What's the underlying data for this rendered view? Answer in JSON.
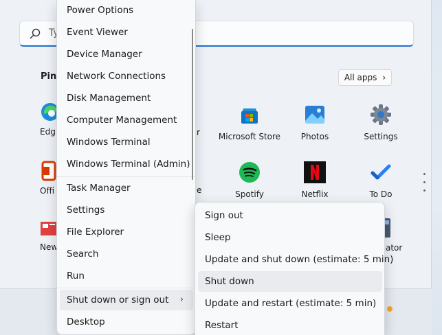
{
  "start_menu": {
    "search_placeholder": "Ty",
    "pinned_title": "Pinn",
    "all_apps_label": "All apps",
    "apps": [
      {
        "label": "Microsoft Store",
        "icon": "store-icon"
      },
      {
        "label": "Photos",
        "icon": "photos-icon"
      },
      {
        "label": "Settings",
        "icon": "gear-icon"
      },
      {
        "label": "Spotify",
        "icon": "spotify-icon"
      },
      {
        "label": "Netflix",
        "icon": "netflix-icon"
      },
      {
        "label": "To Do",
        "icon": "todo-icon"
      }
    ],
    "clipped_labels": [
      "Edg",
      "r",
      "Offi",
      "e",
      "New",
      "ator"
    ]
  },
  "winx_menu": {
    "items": [
      "Power Options",
      "Event Viewer",
      "Device Manager",
      "Network Connections",
      "Disk Management",
      "Computer Management",
      "Windows Terminal",
      "Windows Terminal (Admin)",
      "Task Manager",
      "Settings",
      "File Explorer",
      "Search",
      "Run",
      "Shut down or sign out",
      "Desktop"
    ],
    "chevron": "›"
  },
  "shutdown_submenu": {
    "items": [
      "Sign out",
      "Sleep",
      "Update and shut down (estimate: 5 min)",
      "Shut down",
      "Update and restart (estimate: 5 min)",
      "Restart"
    ]
  },
  "colors": {
    "accent": "#1f6fcf",
    "menu_bg": "#f8f9fa",
    "hover_bg": "#e9ebee"
  }
}
